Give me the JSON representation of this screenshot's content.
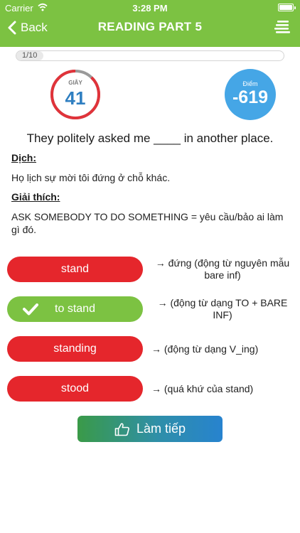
{
  "status_bar": {
    "carrier": "Carrier",
    "time": "3:28 PM"
  },
  "nav": {
    "back_label": "Back",
    "title": "READING PART 5"
  },
  "progress": {
    "label": "1/10",
    "current": 1,
    "total": 10
  },
  "timer": {
    "caption": "GIÂY",
    "value": "41",
    "remaining_fraction": 0.88
  },
  "score": {
    "caption": "Điểm",
    "value": "-619"
  },
  "question": "They politely asked me ____ in another place.",
  "translation": {
    "heading": "Dịch:",
    "text": "Họ lịch sự mời tôi đứng ở chỗ khác."
  },
  "explanation": {
    "heading": "Giải thích:",
    "text": "ASK SOMEBODY TO DO SOMETHING = yêu cầu/bảo ai làm gì đó."
  },
  "options": [
    {
      "label": "stand",
      "note": "→ đứng (động từ nguyên mẫu bare inf)",
      "state": "wrong"
    },
    {
      "label": "to stand",
      "note": "→ (động từ dạng TO +  BARE INF)",
      "state": "correct"
    },
    {
      "label": "standing",
      "note": "→ (động từ dạng V_ing)",
      "state": "wrong"
    },
    {
      "label": "stood",
      "note": "→ (quá khứ của stand)",
      "state": "wrong"
    }
  ],
  "continue_label": "Làm tiếp",
  "colors": {
    "header": "#7cc242",
    "wrong": "#e5262c",
    "correct": "#7cc242",
    "timer_ring": "#e0333a",
    "score_bg": "#45a6e6"
  }
}
